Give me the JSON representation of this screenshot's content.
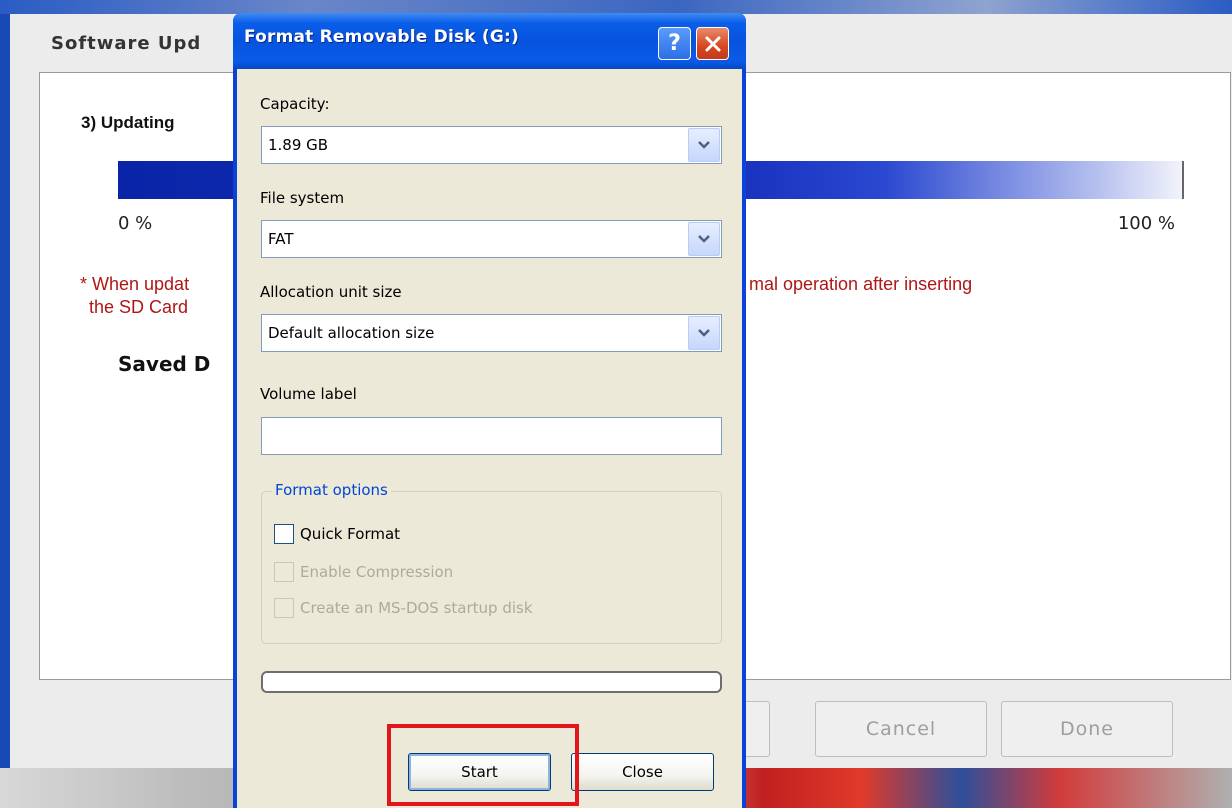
{
  "background_window": {
    "title": "Software Upd",
    "step_label": "3) Updating",
    "progress": {
      "percent": 100,
      "min_label": "0 %",
      "max_label": "100 %"
    },
    "note_line1_left": "* When updat",
    "note_line1_right": "mal operation after inserting",
    "note_line2": "the SD Card",
    "saved_label": "Saved D",
    "buttons": {
      "cancel": "Cancel",
      "done": "Done"
    },
    "colors": {
      "note_text": "#b01616",
      "progress_fill": "#1b34c0"
    }
  },
  "format_dialog": {
    "title": "Format Removable Disk (G:)",
    "help_icon": "help-icon",
    "close_icon": "close-icon",
    "capacity": {
      "label": "Capacity:",
      "value": "1.89 GB"
    },
    "file_system": {
      "label": "File system",
      "value": "FAT"
    },
    "allocation": {
      "label": "Allocation unit size",
      "value": "Default allocation size"
    },
    "volume_label": {
      "label": "Volume label",
      "value": ""
    },
    "format_options": {
      "legend": "Format options",
      "quick_format": {
        "label": "Quick Format",
        "checked": false,
        "enabled": true
      },
      "enable_compression": {
        "label": "Enable Compression",
        "checked": false,
        "enabled": false
      },
      "msdos_startup": {
        "label": "Create an MS-DOS startup disk",
        "checked": false,
        "enabled": false
      }
    },
    "progress": {
      "percent": 0
    },
    "buttons": {
      "start": "Start",
      "close": "Close"
    },
    "colors": {
      "titlebar": "#0653df",
      "client": "#ece9d8",
      "legend_text": "#0046d5",
      "highlight": "#e2151b"
    }
  }
}
